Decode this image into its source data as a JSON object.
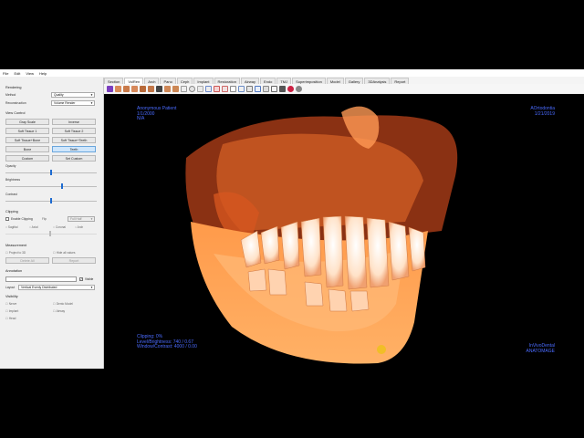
{
  "menu": [
    "File",
    "Edit",
    "View",
    "Help"
  ],
  "tabs": [
    "Section",
    "VolRen",
    "Arch",
    "Pano",
    "Ceph",
    "Implant",
    "Restoration",
    "Airway",
    "Endo",
    "TMJ",
    "Superimposition",
    "Model",
    "Gallery",
    "3DAnalysis",
    "Report"
  ],
  "active_tab": "VolRen",
  "sidebar": {
    "rendering_title": "Rendering",
    "method_label": "Method",
    "method_value": "Quality",
    "reconstruction_label": "Reconstruction",
    "reconstruction_value": "Volume Render",
    "view_control_title": "View Control",
    "buttons": [
      "Gray Scale",
      "Inverse",
      "Soft Tissue 1",
      "Soft Tissue 2",
      "Soft Tissue+Bone",
      "Soft Tissue+Teeth",
      "Bone",
      "Teeth",
      "Custom",
      "Set Custom"
    ],
    "selected_button": "Teeth",
    "opacity_label": "Opacity",
    "opacity": 0.5,
    "brightness_label": "Brightness",
    "brightness": 0.62,
    "contrast_label": "Contrast",
    "contrast": 0.5,
    "clipping_title": "Clipping",
    "enable_clipping_label": "Enable Clipping",
    "flip_label": "Flip",
    "clip_mode_value": "Full Half",
    "clip_options": [
      "Sagittal",
      "Axial",
      "Coronal",
      "Arch"
    ],
    "measurement_title": "Measurement",
    "project_to_3d_label": "Project to 3D",
    "hide_all_values_label": "Hide all values",
    "delete_all_label": "Delete All",
    "report_label": "Report",
    "annotation_title": "Annotation",
    "visible_label": "Visible",
    "layout_label": "Layout",
    "layout_value": "Vertical Evenly Distributed",
    "visibility_title": "Visibility",
    "visibility_items": [
      "Nerve",
      "Dento Model",
      "Implant",
      "Airway",
      "Head"
    ]
  },
  "viewport": {
    "patient_name": "Anonymous Patient",
    "patient_dob": "1/1/2000",
    "patient_extra": "N/A",
    "clinic": "AOrtodontia",
    "date": "1/21/2019",
    "clipping": "Clipping:   0%",
    "level": "Level/Brightness:   740 / 0.67",
    "window": "Window/Contrast:  4000 / 0.00",
    "brand1": "InVivoDental",
    "brand2": "ANATOMAGE"
  },
  "colors": {
    "overlay_text": "#4a6bff",
    "selected_button": "#cfe6fb",
    "slider_thumb": "#1e6bd0",
    "volume_bone": "#ff7a2e"
  }
}
